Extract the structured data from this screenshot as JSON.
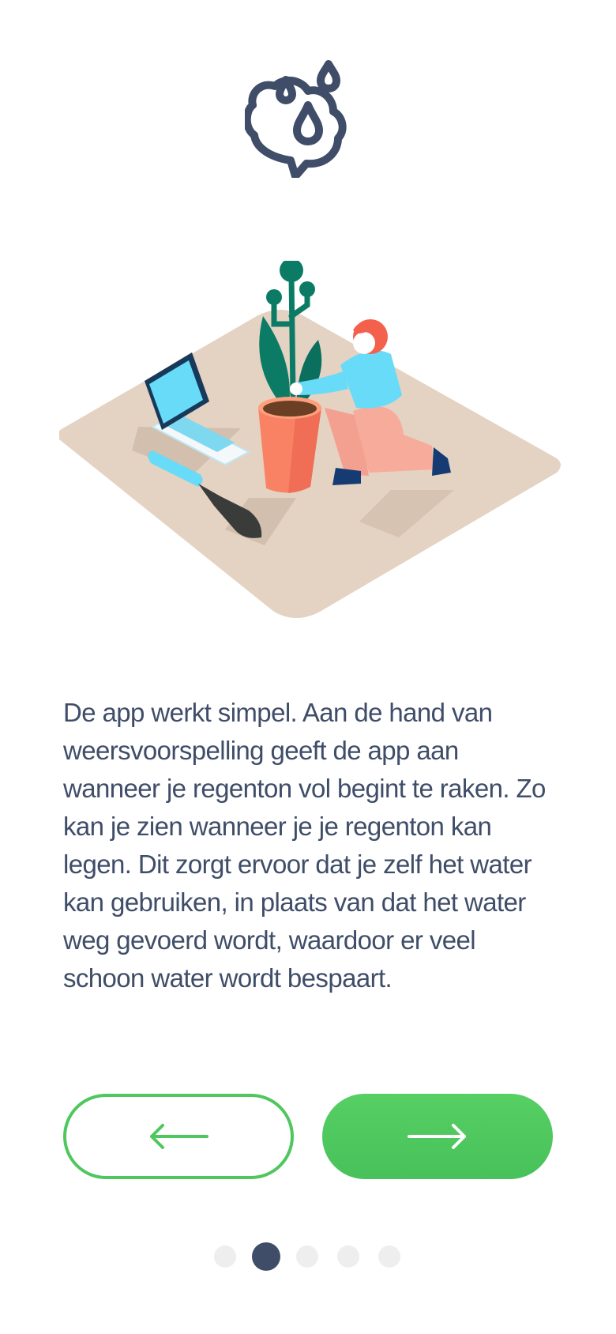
{
  "onboarding": {
    "logo_icon": "brain-raindrops-icon",
    "illustration_icon": "woman-watering-plant-illustration",
    "description": "De app werkt simpel. Aan de hand van weersvoorspelling geeft de app aan wanneer je regenton vol begint te raken. Zo kan je zien wanneer je je regenton kan legen. Dit zorgt ervoor dat je zelf het water kan gebruiken, in plaats van dat het water weg gevoerd wordt, waardoor er veel schoon water wordt bespaart.",
    "back_button_icon": "arrow-left-icon",
    "next_button_icon": "arrow-right-icon",
    "pagination": {
      "total_pages": 5,
      "active_page": 2
    }
  },
  "colors": {
    "text": "#3f4d68",
    "accent_green": "#4fc75e",
    "dot_inactive": "#eeeeee",
    "dot_active": "#3f4d68"
  }
}
